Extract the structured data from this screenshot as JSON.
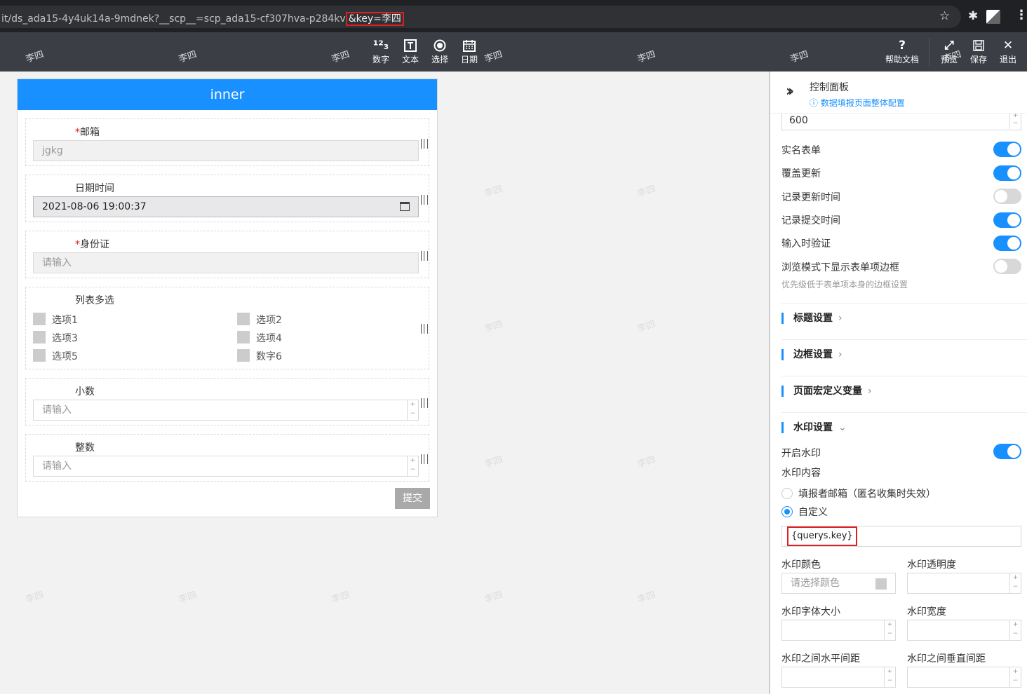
{
  "browser": {
    "url_prefix": "it/ds_ada15-4y4uk14a-9mdnek?__scp__=scp_ada15-cf307hva-p284kv",
    "url_highlight": "&key=李四"
  },
  "toolbar": {
    "items": [
      "数字",
      "文本",
      "选择",
      "日期"
    ],
    "right": [
      "帮助文档",
      "预览",
      "保存",
      "退出"
    ]
  },
  "form": {
    "title": "inner",
    "email": {
      "label": "邮箱",
      "value": "jgkg"
    },
    "datetime": {
      "label": "日期时间",
      "value": "2021-08-06 19:00:37"
    },
    "idcard": {
      "label": "身份证",
      "placeholder": "请输入"
    },
    "multi": {
      "label": "列表多选",
      "options": [
        "选项1",
        "选项2",
        "选项3",
        "选项4",
        "选项5",
        "数字6"
      ]
    },
    "decimal": {
      "label": "小数",
      "placeholder": "请输入"
    },
    "integer": {
      "label": "整数",
      "placeholder": "请输入"
    },
    "submit": "提交"
  },
  "watermark": "李四",
  "panel": {
    "title": "控制面板",
    "subtitle": "数据填报页面整体配置",
    "width_value": "600",
    "toggles": [
      {
        "label": "实名表单",
        "on": true
      },
      {
        "label": "覆盖更新",
        "on": true
      },
      {
        "label": "记录更新时间",
        "on": false
      },
      {
        "label": "记录提交时间",
        "on": true
      },
      {
        "label": "输入时验证",
        "on": true
      },
      {
        "label": "浏览模式下显示表单项边框",
        "on": false
      }
    ],
    "border_hint": "优先级低于表单项本身的边框设置",
    "sections": [
      "标题设置",
      "边框设置",
      "页面宏定义变量",
      "水印设置"
    ],
    "watermark_on": "开启水印",
    "watermark_content": "水印内容",
    "radio_email": "填报者邮箱（匿名收集时失效）",
    "radio_custom": "自定义",
    "custom_value": "{querys.key}",
    "color_label": "水印颜色",
    "color_placeholder": "请选择颜色",
    "opacity_label": "水印透明度",
    "fontsize_label": "水印字体大小",
    "width_label": "水印宽度",
    "hgap_label": "水印之间水平间距",
    "vgap_label": "水印之间垂直间距"
  }
}
